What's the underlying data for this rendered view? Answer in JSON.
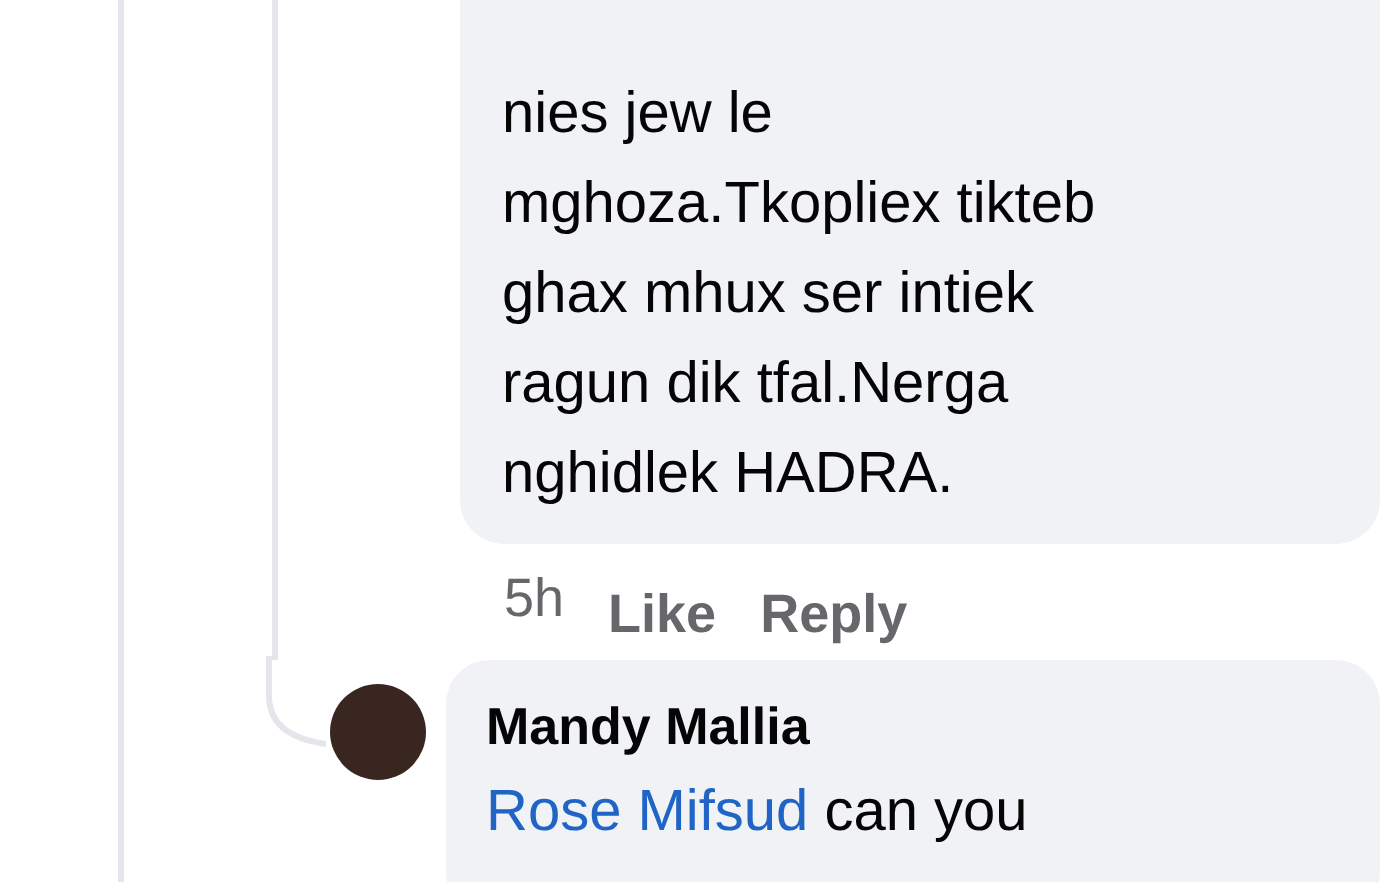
{
  "comments": [
    {
      "lines": [
        "nies jew le",
        "mghoza.Tkopliex tikteb",
        "ghax mhux ser intiek",
        "ragun dik tfal.Nerga",
        "nghidlek HADRA."
      ],
      "time": "5h",
      "actions": [
        "Like",
        "Reply"
      ]
    }
  ],
  "reply": {
    "author": "Mandy Mallia",
    "mention": "Rose Mifsud",
    "text": " can you"
  }
}
